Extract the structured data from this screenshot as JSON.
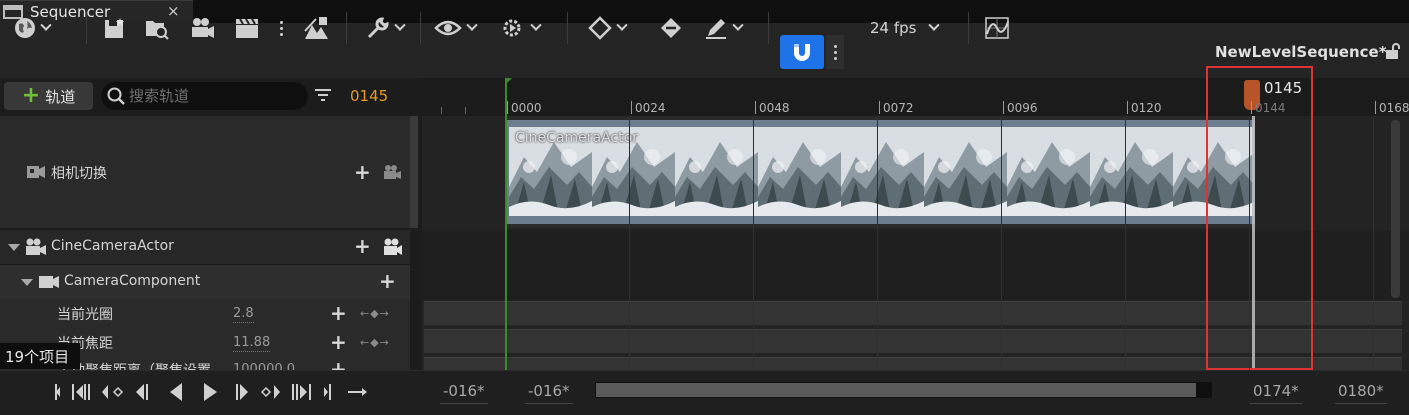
{
  "tab": {
    "title": "Sequencer",
    "close": "×"
  },
  "toolbar": {
    "fps_label": "24 fps",
    "sequence_name": "NewLevelSequence*",
    "snap_active_color": "#1e73e8"
  },
  "tracks_panel": {
    "add_track_label": "轨道",
    "search_placeholder": "搜索轨道",
    "current_frame": "0145",
    "rows": {
      "camera_cuts": "相机切换",
      "cine_camera_actor": "CineCameraActor",
      "camera_component": "CameraComponent",
      "aperture": {
        "label": "当前光圈",
        "value": "2.8"
      },
      "focal_length": {
        "label": "当前焦距",
        "value": "11.88"
      },
      "focus_distance": {
        "label": "手动聚焦距离（聚焦设置",
        "value": "100000.0"
      }
    },
    "tooltip": "19个项目"
  },
  "timeline": {
    "ticks": [
      "0000",
      "0024",
      "0048",
      "0072",
      "0096",
      "0120",
      "0144",
      "0168"
    ],
    "playhead_frame": "0145",
    "clip_label": "CineCameraActor"
  },
  "bottom": {
    "range_start_outer": "-016*",
    "range_start_inner": "-016*",
    "range_end_inner": "0174*",
    "range_end_outer": "0180*"
  }
}
